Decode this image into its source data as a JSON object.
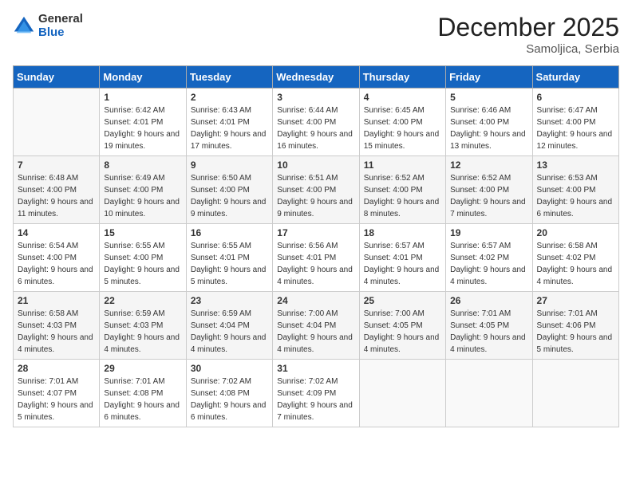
{
  "logo": {
    "general": "General",
    "blue": "Blue"
  },
  "title": "December 2025",
  "subtitle": "Samoljica, Serbia",
  "headers": [
    "Sunday",
    "Monday",
    "Tuesday",
    "Wednesday",
    "Thursday",
    "Friday",
    "Saturday"
  ],
  "weeks": [
    [
      {
        "num": "",
        "sunrise": "",
        "sunset": "",
        "daylight": "",
        "empty": true
      },
      {
        "num": "1",
        "sunrise": "Sunrise: 6:42 AM",
        "sunset": "Sunset: 4:01 PM",
        "daylight": "Daylight: 9 hours and 19 minutes."
      },
      {
        "num": "2",
        "sunrise": "Sunrise: 6:43 AM",
        "sunset": "Sunset: 4:01 PM",
        "daylight": "Daylight: 9 hours and 17 minutes."
      },
      {
        "num": "3",
        "sunrise": "Sunrise: 6:44 AM",
        "sunset": "Sunset: 4:00 PM",
        "daylight": "Daylight: 9 hours and 16 minutes."
      },
      {
        "num": "4",
        "sunrise": "Sunrise: 6:45 AM",
        "sunset": "Sunset: 4:00 PM",
        "daylight": "Daylight: 9 hours and 15 minutes."
      },
      {
        "num": "5",
        "sunrise": "Sunrise: 6:46 AM",
        "sunset": "Sunset: 4:00 PM",
        "daylight": "Daylight: 9 hours and 13 minutes."
      },
      {
        "num": "6",
        "sunrise": "Sunrise: 6:47 AM",
        "sunset": "Sunset: 4:00 PM",
        "daylight": "Daylight: 9 hours and 12 minutes."
      }
    ],
    [
      {
        "num": "7",
        "sunrise": "Sunrise: 6:48 AM",
        "sunset": "Sunset: 4:00 PM",
        "daylight": "Daylight: 9 hours and 11 minutes."
      },
      {
        "num": "8",
        "sunrise": "Sunrise: 6:49 AM",
        "sunset": "Sunset: 4:00 PM",
        "daylight": "Daylight: 9 hours and 10 minutes."
      },
      {
        "num": "9",
        "sunrise": "Sunrise: 6:50 AM",
        "sunset": "Sunset: 4:00 PM",
        "daylight": "Daylight: 9 hours and 9 minutes."
      },
      {
        "num": "10",
        "sunrise": "Sunrise: 6:51 AM",
        "sunset": "Sunset: 4:00 PM",
        "daylight": "Daylight: 9 hours and 9 minutes."
      },
      {
        "num": "11",
        "sunrise": "Sunrise: 6:52 AM",
        "sunset": "Sunset: 4:00 PM",
        "daylight": "Daylight: 9 hours and 8 minutes."
      },
      {
        "num": "12",
        "sunrise": "Sunrise: 6:52 AM",
        "sunset": "Sunset: 4:00 PM",
        "daylight": "Daylight: 9 hours and 7 minutes."
      },
      {
        "num": "13",
        "sunrise": "Sunrise: 6:53 AM",
        "sunset": "Sunset: 4:00 PM",
        "daylight": "Daylight: 9 hours and 6 minutes."
      }
    ],
    [
      {
        "num": "14",
        "sunrise": "Sunrise: 6:54 AM",
        "sunset": "Sunset: 4:00 PM",
        "daylight": "Daylight: 9 hours and 6 minutes."
      },
      {
        "num": "15",
        "sunrise": "Sunrise: 6:55 AM",
        "sunset": "Sunset: 4:00 PM",
        "daylight": "Daylight: 9 hours and 5 minutes."
      },
      {
        "num": "16",
        "sunrise": "Sunrise: 6:55 AM",
        "sunset": "Sunset: 4:01 PM",
        "daylight": "Daylight: 9 hours and 5 minutes."
      },
      {
        "num": "17",
        "sunrise": "Sunrise: 6:56 AM",
        "sunset": "Sunset: 4:01 PM",
        "daylight": "Daylight: 9 hours and 4 minutes."
      },
      {
        "num": "18",
        "sunrise": "Sunrise: 6:57 AM",
        "sunset": "Sunset: 4:01 PM",
        "daylight": "Daylight: 9 hours and 4 minutes."
      },
      {
        "num": "19",
        "sunrise": "Sunrise: 6:57 AM",
        "sunset": "Sunset: 4:02 PM",
        "daylight": "Daylight: 9 hours and 4 minutes."
      },
      {
        "num": "20",
        "sunrise": "Sunrise: 6:58 AM",
        "sunset": "Sunset: 4:02 PM",
        "daylight": "Daylight: 9 hours and 4 minutes."
      }
    ],
    [
      {
        "num": "21",
        "sunrise": "Sunrise: 6:58 AM",
        "sunset": "Sunset: 4:03 PM",
        "daylight": "Daylight: 9 hours and 4 minutes."
      },
      {
        "num": "22",
        "sunrise": "Sunrise: 6:59 AM",
        "sunset": "Sunset: 4:03 PM",
        "daylight": "Daylight: 9 hours and 4 minutes."
      },
      {
        "num": "23",
        "sunrise": "Sunrise: 6:59 AM",
        "sunset": "Sunset: 4:04 PM",
        "daylight": "Daylight: 9 hours and 4 minutes."
      },
      {
        "num": "24",
        "sunrise": "Sunrise: 7:00 AM",
        "sunset": "Sunset: 4:04 PM",
        "daylight": "Daylight: 9 hours and 4 minutes."
      },
      {
        "num": "25",
        "sunrise": "Sunrise: 7:00 AM",
        "sunset": "Sunset: 4:05 PM",
        "daylight": "Daylight: 9 hours and 4 minutes."
      },
      {
        "num": "26",
        "sunrise": "Sunrise: 7:01 AM",
        "sunset": "Sunset: 4:05 PM",
        "daylight": "Daylight: 9 hours and 4 minutes."
      },
      {
        "num": "27",
        "sunrise": "Sunrise: 7:01 AM",
        "sunset": "Sunset: 4:06 PM",
        "daylight": "Daylight: 9 hours and 5 minutes."
      }
    ],
    [
      {
        "num": "28",
        "sunrise": "Sunrise: 7:01 AM",
        "sunset": "Sunset: 4:07 PM",
        "daylight": "Daylight: 9 hours and 5 minutes."
      },
      {
        "num": "29",
        "sunrise": "Sunrise: 7:01 AM",
        "sunset": "Sunset: 4:08 PM",
        "daylight": "Daylight: 9 hours and 6 minutes."
      },
      {
        "num": "30",
        "sunrise": "Sunrise: 7:02 AM",
        "sunset": "Sunset: 4:08 PM",
        "daylight": "Daylight: 9 hours and 6 minutes."
      },
      {
        "num": "31",
        "sunrise": "Sunrise: 7:02 AM",
        "sunset": "Sunset: 4:09 PM",
        "daylight": "Daylight: 9 hours and 7 minutes."
      },
      {
        "num": "",
        "empty": true
      },
      {
        "num": "",
        "empty": true
      },
      {
        "num": "",
        "empty": true
      }
    ]
  ]
}
